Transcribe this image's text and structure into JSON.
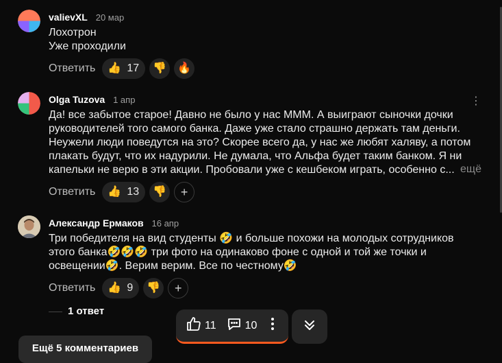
{
  "comments": [
    {
      "author": "valievXL",
      "date": "20 мар",
      "lines": [
        "Лохотрон",
        "Уже проходили"
      ],
      "reply_label": "Ответить",
      "like_count": "17"
    },
    {
      "author": "Olga Tuzova",
      "date": "1 апр",
      "lines": [
        "Да! все забытое старое! Давно не было у нас МММ. А выиграют сыночки дочки",
        "руководителей того самого банка. Даже уже стало страшно держать там деньги.",
        "Неужели люди поведутся на это? Скорее всего да, у нас же любят халяву, а потом",
        "плакать будут, что их надурили. Не думала, что Альфа будет таким банком. Я ни",
        "капельки не верю в эти акции. Пробовали уже с кешбеком играть, особенно с..."
      ],
      "more_label": "ещё",
      "reply_label": "Ответить",
      "like_count": "13"
    },
    {
      "author": "Александр Ермаков",
      "date": "16 апр",
      "lines": [
        "Три победителя на вид студенты 🤣 и больше похожи на молодых сотрудников",
        "этого банка🤣🤣🤣 три фото на одинаково фоне с одной и той же точки и",
        "освещении🤣. Верим верим. Все по честному🤣"
      ],
      "reply_label": "Ответить",
      "like_count": "9",
      "replies_label": "1 ответ"
    }
  ],
  "more_comments_label": "Ещё 5 комментариев",
  "floating_bar": {
    "likes": "11",
    "comments": "10"
  },
  "colors": {
    "accent": "#ff5a1f",
    "background": "#0b0b0b",
    "chip": "#232323"
  },
  "icons": [
    "thumbs-up-icon",
    "thumbs-down-icon",
    "fire-icon",
    "plus-icon",
    "kebab-icon",
    "comment-icon",
    "double-chevron-down-icon"
  ]
}
